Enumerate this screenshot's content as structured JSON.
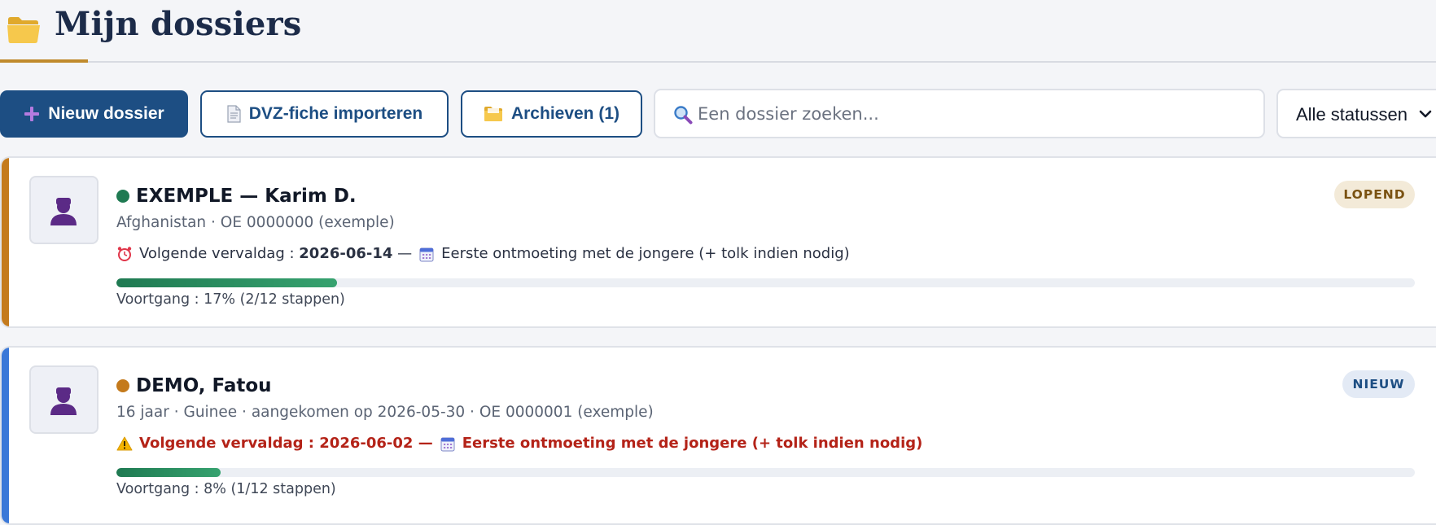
{
  "header": {
    "title": "Mijn dossiers",
    "icon": "folder-icon"
  },
  "toolbar": {
    "new_label": "Nieuw dossier",
    "import_label": "DVZ-fiche importeren",
    "archive_label": "Archieven (1)",
    "search_placeholder": "Een dossier zoeken...",
    "status_filter": "Alle statussen"
  },
  "colors": {
    "primary": "#1d4e83",
    "accent": "#c08a2c",
    "in_progress_stripe": "#c47a1c",
    "new_stripe": "#3a78d8",
    "warning": "#b42318"
  },
  "dossiers": [
    {
      "name": "EXEMPLE — Karim D.",
      "status_dot": "#1f7a52",
      "meta": "Afghanistan · OE 0000000 (exemple)",
      "deadline_prefix": "Volgende vervaldag :",
      "deadline_date": "2026-06-14",
      "deadline_sep": "—",
      "deadline_task": "Eerste ontmoeting met de jongere (+ tolk indien nodig)",
      "deadline_icon": "alarm-clock-icon",
      "progress": 0.17,
      "progress_text": "Voortgang : 17% (2/12 stappen)",
      "badge": "LOPEND"
    },
    {
      "name": "DEMO, Fatou",
      "status_dot": "#c47a1c",
      "meta": "16 jaar · Guinee · aangekomen op 2026-05-30 · OE 0000001 (exemple)",
      "deadline_prefix": "Volgende vervaldag :",
      "deadline_date": "2026-06-02",
      "deadline_sep": "—",
      "deadline_task": "Eerste ontmoeting met de jongere (+ tolk indien nodig)",
      "deadline_icon": "warning-icon",
      "progress": 0.08,
      "progress_text": "Voortgang : 8% (1/12 stappen)",
      "badge": "NIEUW"
    }
  ]
}
